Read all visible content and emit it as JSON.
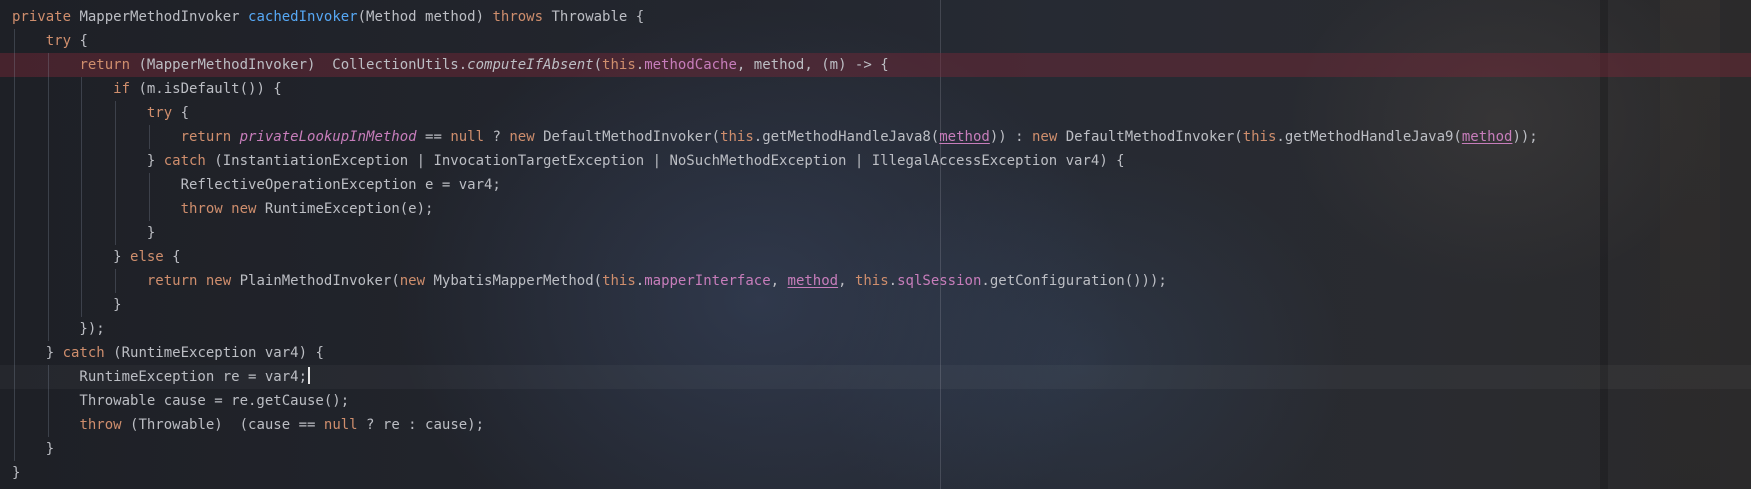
{
  "colors": {
    "keyword": "#cf8e6d",
    "method_decl": "#56a8f5",
    "field": "#c77dbb",
    "plain": "#bcbec4",
    "breakpoint_line": "#5a2a35"
  },
  "code_lines": [
    {
      "kind": "normal",
      "tokens": [
        {
          "t": "private",
          "c": "kw"
        },
        {
          "t": " MapperMethodInvoker "
        },
        {
          "t": "cachedInvoker",
          "c": "fn"
        },
        {
          "t": "(Method method) "
        },
        {
          "t": "throws",
          "c": "kw"
        },
        {
          "t": " Throwable {"
        }
      ]
    },
    {
      "kind": "normal",
      "tokens": [
        {
          "t": "    "
        },
        {
          "t": "try",
          "c": "kw"
        },
        {
          "t": " {"
        }
      ]
    },
    {
      "kind": "breakpoint",
      "tokens": [
        {
          "t": "        "
        },
        {
          "t": "return",
          "c": "kw"
        },
        {
          "t": " (MapperMethodInvoker)  CollectionUtils."
        },
        {
          "t": "computeIfAbsent",
          "c": "itf"
        },
        {
          "t": "("
        },
        {
          "t": "this",
          "c": "kw"
        },
        {
          "t": "."
        },
        {
          "t": "methodCache",
          "c": "fld"
        },
        {
          "t": ", method, (m) -> {"
        }
      ]
    },
    {
      "kind": "normal",
      "tokens": [
        {
          "t": "            "
        },
        {
          "t": "if",
          "c": "kw"
        },
        {
          "t": " (m.isDefault()) {"
        }
      ]
    },
    {
      "kind": "normal",
      "tokens": [
        {
          "t": "                "
        },
        {
          "t": "try",
          "c": "kw"
        },
        {
          "t": " {"
        }
      ]
    },
    {
      "kind": "normal",
      "tokens": [
        {
          "t": "                    "
        },
        {
          "t": "return",
          "c": "kw"
        },
        {
          "t": " "
        },
        {
          "t": "privateLookupInMethod",
          "c": "sfld"
        },
        {
          "t": " == "
        },
        {
          "t": "null",
          "c": "kw"
        },
        {
          "t": " ? "
        },
        {
          "t": "new",
          "c": "kw"
        },
        {
          "t": " DefaultMethodInvoker("
        },
        {
          "t": "this",
          "c": "kw"
        },
        {
          "t": ".getMethodHandleJava8("
        },
        {
          "t": "method",
          "c": "ul"
        },
        {
          "t": ")) : "
        },
        {
          "t": "new",
          "c": "kw"
        },
        {
          "t": " DefaultMethodInvoker("
        },
        {
          "t": "this",
          "c": "kw"
        },
        {
          "t": ".getMethodHandleJava9("
        },
        {
          "t": "method",
          "c": "ul"
        },
        {
          "t": "));"
        }
      ]
    },
    {
      "kind": "normal",
      "tokens": [
        {
          "t": "                } "
        },
        {
          "t": "catch",
          "c": "kw"
        },
        {
          "t": " (InstantiationException | InvocationTargetException | NoSuchMethodException | IllegalAccessException var4) {"
        }
      ]
    },
    {
      "kind": "normal",
      "tokens": [
        {
          "t": "                    ReflectiveOperationException e = var4;"
        }
      ]
    },
    {
      "kind": "normal",
      "tokens": [
        {
          "t": "                    "
        },
        {
          "t": "throw",
          "c": "kw"
        },
        {
          "t": " "
        },
        {
          "t": "new",
          "c": "kw"
        },
        {
          "t": " RuntimeException(e);"
        }
      ]
    },
    {
      "kind": "normal",
      "tokens": [
        {
          "t": "                }"
        }
      ]
    },
    {
      "kind": "normal",
      "tokens": [
        {
          "t": "            } "
        },
        {
          "t": "else",
          "c": "kw"
        },
        {
          "t": " {"
        }
      ]
    },
    {
      "kind": "normal",
      "tokens": [
        {
          "t": "                "
        },
        {
          "t": "return",
          "c": "kw"
        },
        {
          "t": " "
        },
        {
          "t": "new",
          "c": "kw"
        },
        {
          "t": " PlainMethodInvoker("
        },
        {
          "t": "new",
          "c": "kw"
        },
        {
          "t": " MybatisMapperMethod("
        },
        {
          "t": "this",
          "c": "kw"
        },
        {
          "t": "."
        },
        {
          "t": "mapperInterface",
          "c": "fld"
        },
        {
          "t": ", "
        },
        {
          "t": "method",
          "c": "ul"
        },
        {
          "t": ", "
        },
        {
          "t": "this",
          "c": "kw"
        },
        {
          "t": "."
        },
        {
          "t": "sqlSession",
          "c": "fld"
        },
        {
          "t": ".getConfiguration()));"
        }
      ]
    },
    {
      "kind": "normal",
      "tokens": [
        {
          "t": "            }"
        }
      ]
    },
    {
      "kind": "normal",
      "tokens": [
        {
          "t": "        });"
        }
      ]
    },
    {
      "kind": "normal",
      "tokens": [
        {
          "t": "    } "
        },
        {
          "t": "catch",
          "c": "kw"
        },
        {
          "t": " (RuntimeException var4) {"
        }
      ]
    },
    {
      "kind": "current",
      "caret": true,
      "tokens": [
        {
          "t": "        RuntimeException re = var4;"
        }
      ]
    },
    {
      "kind": "normal",
      "tokens": [
        {
          "t": "        Throwable cause = re.getCause();"
        }
      ]
    },
    {
      "kind": "normal",
      "tokens": [
        {
          "t": "        "
        },
        {
          "t": "throw",
          "c": "kw"
        },
        {
          "t": " (Throwable)  (cause == "
        },
        {
          "t": "null",
          "c": "kw"
        },
        {
          "t": " ? re : cause);"
        }
      ]
    },
    {
      "kind": "normal",
      "tokens": [
        {
          "t": "    }"
        }
      ]
    },
    {
      "kind": "normal",
      "tokens": [
        {
          "t": "}"
        }
      ]
    }
  ]
}
